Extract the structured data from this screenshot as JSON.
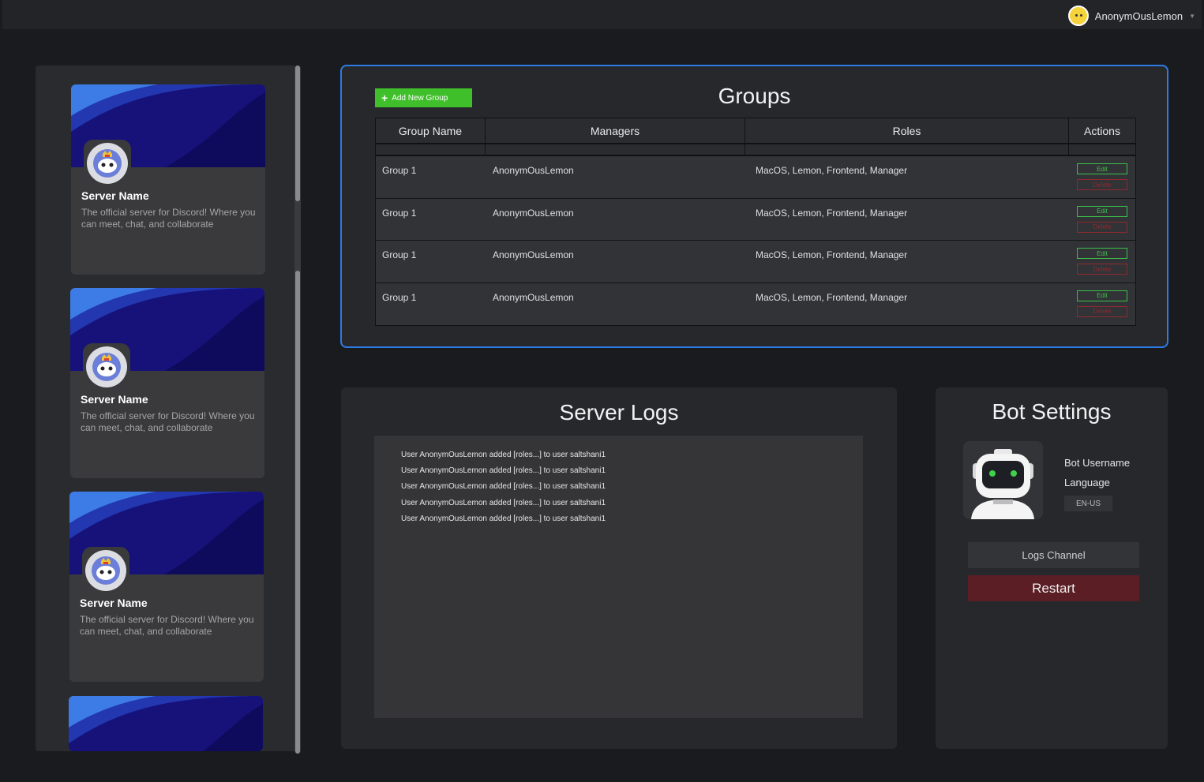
{
  "header": {
    "username": "AnonymOusLemon"
  },
  "sidebar": {
    "servers": [
      {
        "name": "Server Name",
        "description": "The official server for Discord! Where you can meet, chat, and collaborate"
      },
      {
        "name": "Server Name",
        "description": "The official server for Discord! Where you can meet, chat, and collaborate"
      },
      {
        "name": "Server Name",
        "description": "The official server for Discord! Where you can meet, chat, and collaborate"
      }
    ]
  },
  "groups": {
    "title": "Groups",
    "add_button": "Add New Group",
    "columns": [
      "Group Name",
      "Managers",
      "Roles",
      "Actions"
    ],
    "rows": [
      {
        "name": "Group 1",
        "managers": "AnonymOusLemon",
        "roles": "MacOS, Lemon, Frontend, Manager",
        "edit": "Edit",
        "delete": "Delete"
      },
      {
        "name": "Group 1",
        "managers": "AnonymOusLemon",
        "roles": "MacOS, Lemon, Frontend, Manager",
        "edit": "Edit",
        "delete": "Delete"
      },
      {
        "name": "Group 1",
        "managers": "AnonymOusLemon",
        "roles": "MacOS, Lemon, Frontend, Manager",
        "edit": "Edit",
        "delete": "Delete"
      },
      {
        "name": "Group 1",
        "managers": "AnonymOusLemon",
        "roles": "MacOS, Lemon, Frontend, Manager",
        "edit": "Edit",
        "delete": "Delete"
      }
    ]
  },
  "logs": {
    "title": "Server Logs",
    "lines": [
      "User AnonymOusLemon added [roles...] to user saltshani1",
      "User AnonymOusLemon added [roles...] to user saltshani1",
      "User AnonymOusLemon added [roles...] to user saltshani1",
      "User AnonymOusLemon added [roles...] to user saltshani1",
      "User AnonymOusLemon added [roles...] to user saltshani1"
    ]
  },
  "bot": {
    "title": "Bot Settings",
    "username_label": "Bot Username",
    "language_label": "Language",
    "language_value": "EN-US",
    "logs_channel_label": "Logs Channel",
    "restart_label": "Restart"
  },
  "colors": {
    "accent_blue": "#2d7be5",
    "add_green": "#3fbf2a",
    "edit_green": "#3cc04a",
    "delete_red": "#8e2a30",
    "restart_red": "#5a1e24"
  }
}
